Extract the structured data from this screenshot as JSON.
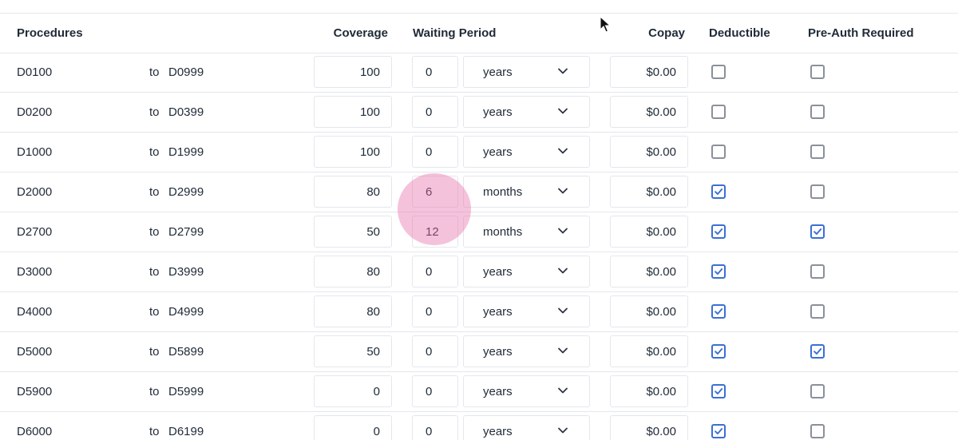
{
  "header": {
    "procedures": "Procedures",
    "coverage": "Coverage",
    "waiting_period": "Waiting Period",
    "copay": "Copay",
    "deductible": "Deductible",
    "preauth": "Pre-Auth Required"
  },
  "icons": {
    "unit_dropdown": "chevron-down-icon",
    "checkbox_checked": "checkmark-icon",
    "pointer": "mouse-cursor-icon"
  },
  "colors": {
    "checkbox_checked": "#3b6fd4",
    "checkbox_unchecked": "#8a9099",
    "touch_indicator": "#e66eaa"
  },
  "rows": [
    {
      "from": "D0100",
      "to_label": "to",
      "to": "D0999",
      "coverage": "100",
      "wait": "0",
      "unit": "years",
      "copay": "$0.00",
      "deductible": false,
      "preauth": false
    },
    {
      "from": "D0200",
      "to_label": "to",
      "to": "D0399",
      "coverage": "100",
      "wait": "0",
      "unit": "years",
      "copay": "$0.00",
      "deductible": false,
      "preauth": false
    },
    {
      "from": "D1000",
      "to_label": "to",
      "to": "D1999",
      "coverage": "100",
      "wait": "0",
      "unit": "years",
      "copay": "$0.00",
      "deductible": false,
      "preauth": false
    },
    {
      "from": "D2000",
      "to_label": "to",
      "to": "D2999",
      "coverage": "80",
      "wait": "6",
      "unit": "months",
      "copay": "$0.00",
      "deductible": true,
      "preauth": false
    },
    {
      "from": "D2700",
      "to_label": "to",
      "to": "D2799",
      "coverage": "50",
      "wait": "12",
      "unit": "months",
      "copay": "$0.00",
      "deductible": true,
      "preauth": true
    },
    {
      "from": "D3000",
      "to_label": "to",
      "to": "D3999",
      "coverage": "80",
      "wait": "0",
      "unit": "years",
      "copay": "$0.00",
      "deductible": true,
      "preauth": false
    },
    {
      "from": "D4000",
      "to_label": "to",
      "to": "D4999",
      "coverage": "80",
      "wait": "0",
      "unit": "years",
      "copay": "$0.00",
      "deductible": true,
      "preauth": false
    },
    {
      "from": "D5000",
      "to_label": "to",
      "to": "D5899",
      "coverage": "50",
      "wait": "0",
      "unit": "years",
      "copay": "$0.00",
      "deductible": true,
      "preauth": true
    },
    {
      "from": "D5900",
      "to_label": "to",
      "to": "D5999",
      "coverage": "0",
      "wait": "0",
      "unit": "years",
      "copay": "$0.00",
      "deductible": true,
      "preauth": false
    },
    {
      "from": "D6000",
      "to_label": "to",
      "to": "D6199",
      "coverage": "0",
      "wait": "0",
      "unit": "years",
      "copay": "$0.00",
      "deductible": true,
      "preauth": false
    }
  ]
}
